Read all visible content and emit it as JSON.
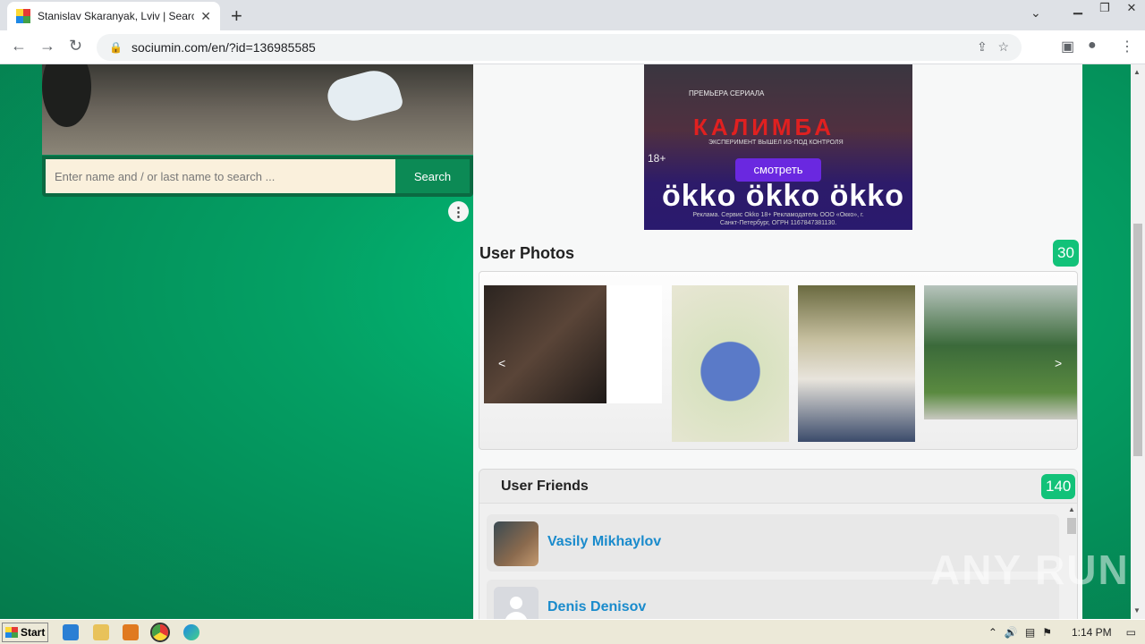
{
  "browser": {
    "tab_title": "Stanislav Skaranyak, Lviv | Search In",
    "tab_close": "✕",
    "new_tab": "+",
    "url": "sociumin.com/en/?id=136985585"
  },
  "search": {
    "placeholder": "Enter name and / or last name to search ...",
    "button_label": "Search"
  },
  "ad": {
    "premiere": "ПРЕМЬЕРА СЕРИАЛА",
    "title": "КАЛИМБА",
    "subtitle": "ЭКСПЕРИМЕНТ ВЫШЕЛ ИЗ-ПОД КОНТРОЛЯ",
    "age": "18+",
    "watch_button": "смотреть",
    "logos": "ökko ökko ökko",
    "fine_print": "Реклама. Сервис Okko 18+ Рекламодатель ООО «Окко», г. Санкт-Петербург, ОГРН 1167847381130."
  },
  "photos": {
    "title": "User Photos",
    "count": "30",
    "prev": "<",
    "next": ">"
  },
  "friends": {
    "title": "User Friends",
    "count": "140",
    "items": [
      {
        "name": "Vasily Mikhaylov"
      },
      {
        "name": "Denis Denisov"
      }
    ]
  },
  "watermark": "ANY RUN",
  "taskbar": {
    "start": "Start",
    "clock": "1:14 PM"
  }
}
